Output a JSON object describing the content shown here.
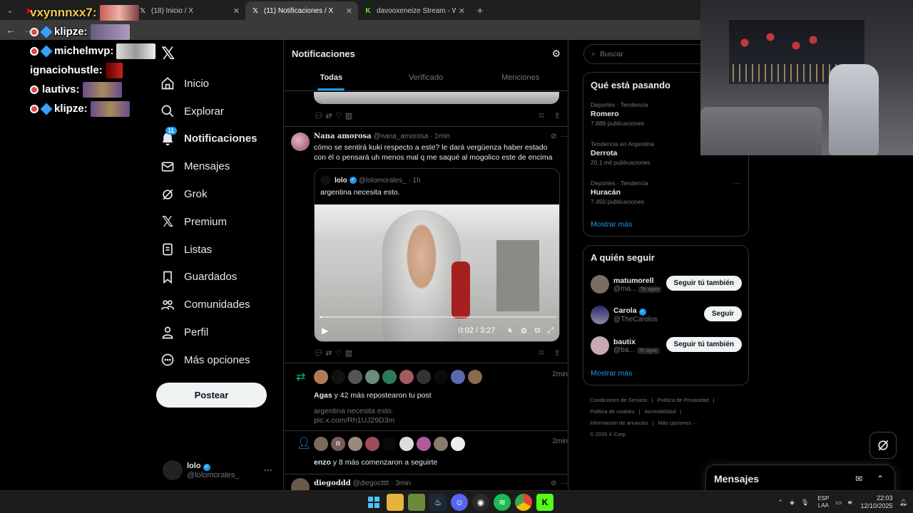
{
  "browser": {
    "tabs": [
      {
        "title": "",
        "favicon": "youtube-icon",
        "active": false
      },
      {
        "title": "(18) Inicio / X",
        "favicon": "x-icon",
        "active": false
      },
      {
        "title": "(11) Notificaciones / X",
        "favicon": "x-icon",
        "active": true
      },
      {
        "title": "davooxeneize Stream - Watch L",
        "favicon": "kick-icon",
        "active": false
      }
    ],
    "new_tab": "+"
  },
  "overlay_chat": [
    {
      "user": "vxynnnxx7:",
      "emote": true
    },
    {
      "user": "klipze:",
      "emote": true
    },
    {
      "user": "michelmvp:",
      "emote": true
    },
    {
      "user": "ignaciohustle:",
      "emote": true
    },
    {
      "user": "lautivs:",
      "emote": true
    },
    {
      "user": "klipze:",
      "emote": true
    }
  ],
  "nav": {
    "items": [
      {
        "label": "Inicio",
        "icon": "home-icon"
      },
      {
        "label": "Explorar",
        "icon": "search-icon"
      },
      {
        "label": "Notificaciones",
        "icon": "bell-icon",
        "badge": "11",
        "active": true
      },
      {
        "label": "Mensajes",
        "icon": "mail-icon"
      },
      {
        "label": "Grok",
        "icon": "grok-icon"
      },
      {
        "label": "Premium",
        "icon": "x-icon"
      },
      {
        "label": "Listas",
        "icon": "list-icon"
      },
      {
        "label": "Guardados",
        "icon": "bookmark-icon"
      },
      {
        "label": "Comunidades",
        "icon": "communities-icon"
      },
      {
        "label": "Perfil",
        "icon": "person-icon"
      },
      {
        "label": "Más opciones",
        "icon": "more-circle-icon"
      }
    ],
    "post_label": "Postear",
    "account": {
      "name": "lolo",
      "handle": "@lolomorales_"
    }
  },
  "timeline": {
    "title": "Notificaciones",
    "tabs": [
      "Todas",
      "Verificado",
      "Menciones"
    ],
    "tweet": {
      "name": "Nana amorosa",
      "handle": "@nana_amorosa",
      "time": "· 1min",
      "text": "cómo se sentirá kuki respecto a este? le dará vergüenza haber estado con él o pensará uh menos mal q me saqué al mogolico este de encima",
      "quote": {
        "name": "lolo",
        "handle": "@lolomorales_",
        "time": "· 1h",
        "text": "argentina necesita esto.",
        "video_time": "0:02 / 3:27",
        "progress": 0.01
      }
    },
    "repost_notif": {
      "time": "2min",
      "actor": "Agas",
      "text": " y 42 más repostearon tu post",
      "sub1": "argentina necesita esto.",
      "sub2": "pic.x.com/Rh1UJ29D3m"
    },
    "follow_notif": {
      "time": "2min",
      "actor": "enzo",
      "text": " y 8 más comenzaron a seguirte"
    },
    "next_tweet": {
      "name": "diegoddd",
      "handle": "@diegoctttt",
      "time": "· 3min"
    }
  },
  "sidebar": {
    "search_placeholder": "Buscar",
    "trends_title": "Qué está pasando",
    "trends": [
      {
        "meta": "Deportes · Tendencia",
        "name": "Romero",
        "count": "7.889 publicaciones"
      },
      {
        "meta": "Tendencia en Argentina",
        "name": "Derrota",
        "count": "20,1 mil publicaciones"
      },
      {
        "meta": "Deportes · Tendencia",
        "name": "Huracán",
        "count": "7.450 publicaciones"
      }
    ],
    "show_more": "Mostrar más",
    "who_title": "A quién seguir",
    "who": [
      {
        "name": "matumorell",
        "handle": "@ma...",
        "tag": "Te sigue",
        "button": "Seguir tú también",
        "verified": false
      },
      {
        "name": "Carola",
        "handle": "@TheCarolos",
        "tag": "",
        "button": "Seguir",
        "verified": true
      },
      {
        "name": "bautix",
        "handle": "@ba...",
        "tag": "Te sigue",
        "button": "Seguir tú también",
        "verified": false
      }
    ],
    "footer": [
      "Condiciones de Servicio",
      "|",
      "Política de Privacidad",
      "|",
      "Política de cookies",
      "|",
      "Accesibilidad",
      "|",
      "Información de anuncios",
      "|",
      "Más opciones ···",
      "© 2025 X Corp."
    ]
  },
  "messages_drawer": {
    "title": "Mensajes"
  },
  "taskbar": {
    "lang_1": "ESP",
    "lang_2": "LAA",
    "time": "22:03",
    "date": "12/10/2025"
  }
}
